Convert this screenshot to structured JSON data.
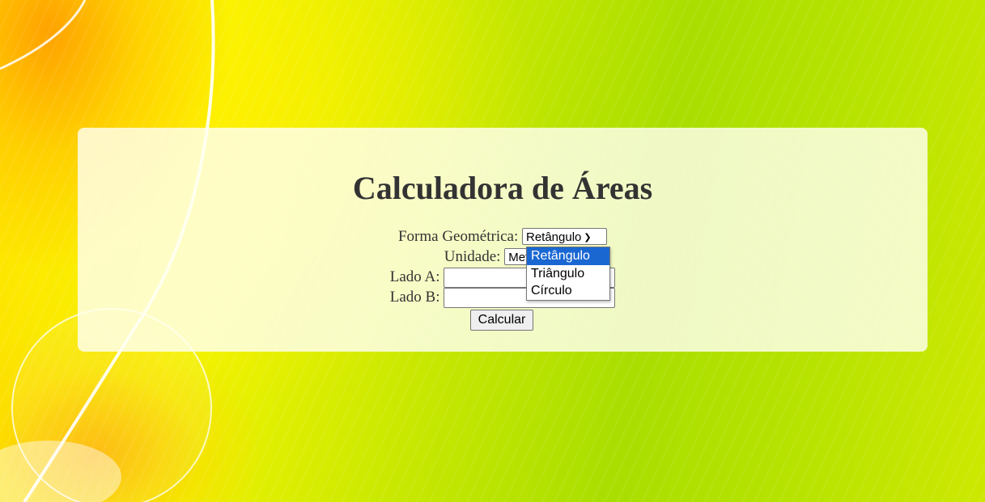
{
  "page": {
    "title": "Calculadora de Áreas"
  },
  "form": {
    "shape_label": "Forma Geométrica:",
    "shape_value": "Retângulo",
    "unit_label": "Unidade:",
    "unit_value": "Metro",
    "side_a_label": "Lado A:",
    "side_a_value": "",
    "side_b_label": "Lado B:",
    "side_b_value": "",
    "calculate_label": "Calcular"
  },
  "dropdown": {
    "options": [
      "Retângulo",
      "Triângulo",
      "Círculo"
    ],
    "selected": "Retângulo"
  },
  "colors": {
    "selected_option": "#1a67d2",
    "card_background": "#fffff0",
    "title_text": "#333333"
  }
}
